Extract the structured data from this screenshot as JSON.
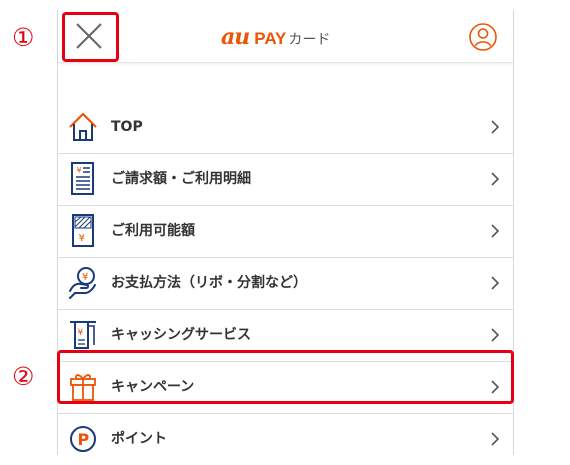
{
  "header": {
    "logo_au": "au",
    "logo_pay": "PAY",
    "logo_card": "カード",
    "close_icon": "close-icon",
    "user_icon": "user-icon"
  },
  "menu": {
    "items": [
      {
        "label": "TOP",
        "icon": "home-icon"
      },
      {
        "label": "ご請求額・ご利用明細",
        "icon": "bill-statement-icon"
      },
      {
        "label": "ご利用可能額",
        "icon": "available-amount-icon"
      },
      {
        "label": "お支払方法（リボ・分割など）",
        "icon": "payment-method-icon"
      },
      {
        "label": "キャッシングサービス",
        "icon": "cashing-icon"
      },
      {
        "label": "キャンペーン",
        "icon": "gift-icon"
      },
      {
        "label": "ポイント",
        "icon": "point-icon"
      }
    ]
  },
  "annotations": {
    "marker_1": "①",
    "marker_2": "②"
  },
  "colors": {
    "accent": "#eb5505",
    "icon_blue": "#1b3a7a",
    "highlight_red": "#e60012"
  }
}
